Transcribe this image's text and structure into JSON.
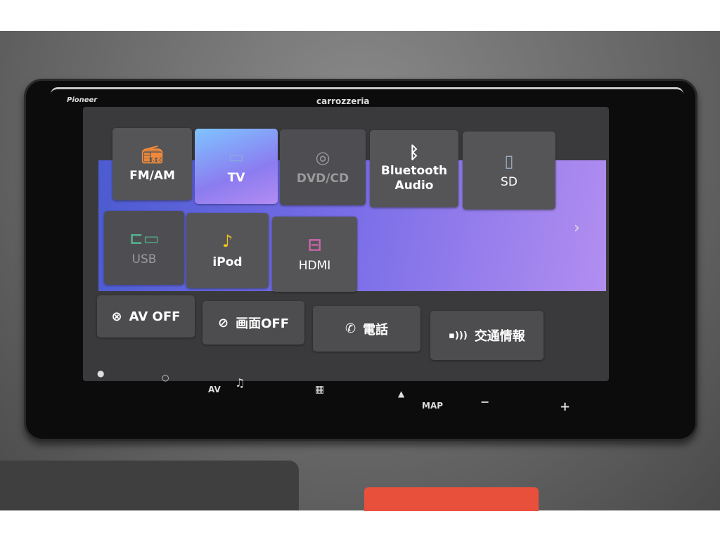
{
  "device": {
    "brand_left": "Pioneer",
    "brand_right": "carrozzeria"
  },
  "tiles": [
    {
      "label": "FM/AM",
      "icon": "radio-icon",
      "state": "normal"
    },
    {
      "label": "TV",
      "icon": "tv-icon",
      "state": "selected"
    },
    {
      "label": "DVD/CD",
      "icon": "disc-icon",
      "state": "disabled"
    },
    {
      "label": "Bluetooth Audio",
      "icon": "bluetooth-icon",
      "state": "normal"
    },
    {
      "label": "SD",
      "icon": "sd-card-icon",
      "state": "normal"
    },
    {
      "label": "USB",
      "icon": "usb-icon",
      "state": "disabled"
    },
    {
      "label": "iPod",
      "icon": "music-note-icon",
      "state": "normal"
    },
    {
      "label": "HDMI",
      "icon": "hdmi-icon",
      "state": "normal"
    }
  ],
  "buttons": {
    "av_off": "AV OFF",
    "screen_off": "画面OFF",
    "phone": "電話",
    "traffic": "交通情報"
  },
  "hardware": {
    "av": "AV",
    "map": "MAP",
    "minus": "−",
    "plus": "+"
  },
  "colors": {
    "accent_gradient_start": "#4b5bd0",
    "accent_gradient_end": "#b28ef0",
    "selected_tile": "#8b7cf0"
  }
}
